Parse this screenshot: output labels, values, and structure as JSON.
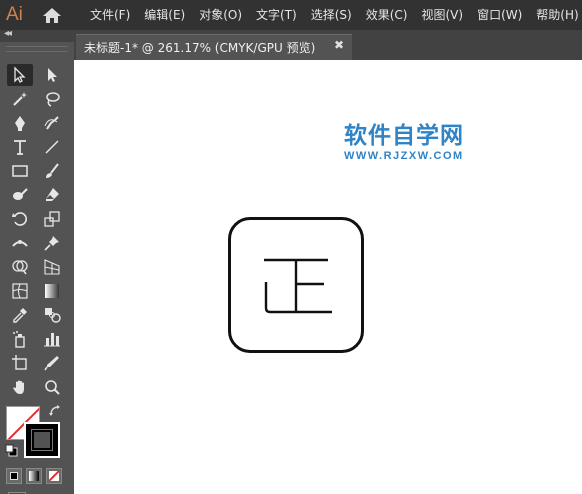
{
  "app": {
    "logo": "Ai"
  },
  "menu": [
    "文件(F)",
    "编辑(E)",
    "对象(O)",
    "文字(T)",
    "选择(S)",
    "效果(C)",
    "视图(V)",
    "窗口(W)",
    "帮助(H)"
  ],
  "toolpanel": {
    "collapse_label": "◂◂"
  },
  "document": {
    "tab_title": "未标题-1* @ 261.17% (CMYK/GPU 预览)",
    "close_glyph": "✖"
  },
  "canvas": {
    "watermark_title": "软件自学网",
    "watermark_url": "WWW.RJZXW.COM"
  },
  "colors": {
    "menubar": "#323232",
    "panel": "#535353",
    "accent_logo": "#d0834a",
    "watermark": "#2f84c8"
  },
  "tools": [
    "selection-tool",
    "direct-selection-tool",
    "magic-wand-tool",
    "lasso-tool",
    "pen-tool",
    "curvature-tool",
    "type-tool",
    "line-tool",
    "rectangle-tool",
    "paintbrush-tool",
    "blob-brush-tool",
    "eraser-tool",
    "rotate-tool",
    "scale-tool",
    "width-tool",
    "puppet-warp-tool",
    "shape-builder-tool",
    "perspective-grid-tool",
    "mesh-tool",
    "gradient-tool",
    "eyedropper-tool",
    "blend-tool",
    "symbol-sprayer-tool",
    "column-graph-tool",
    "artboard-tool",
    "slice-tool",
    "hand-tool",
    "zoom-tool"
  ]
}
